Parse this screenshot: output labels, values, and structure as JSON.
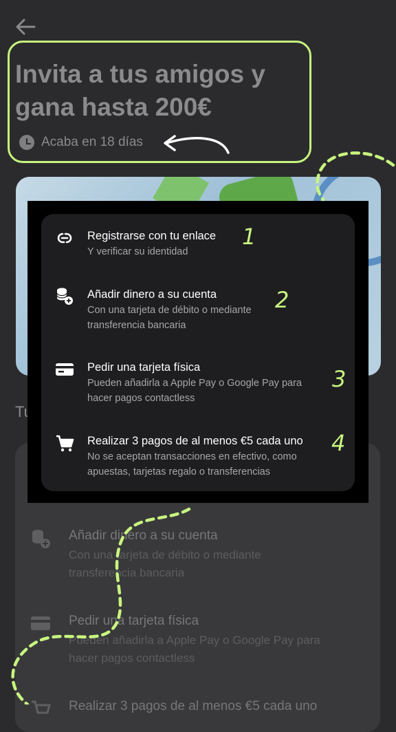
{
  "header": {
    "title": "Invita a tus amigos y gana hasta 200€",
    "countdown": "Acaba en 18 días"
  },
  "section_label": "Tu",
  "overlay_steps": [
    {
      "title": "Registrarse con tu enlace",
      "subtitle": "Y verificar su identidad",
      "number": "1",
      "icon": "link-icon"
    },
    {
      "title": "Añadir dinero a su cuenta",
      "subtitle": "Con una tarjeta de débito o mediante transferencia bancaria",
      "number": "2",
      "icon": "coins-add-icon"
    },
    {
      "title": "Pedir una tarjeta física",
      "subtitle": "Pueden añadirla a Apple Pay o Google Pay para hacer pagos contactless",
      "number": "3",
      "icon": "card-icon"
    },
    {
      "title": "Realizar 3 pagos de al menos €5 cada uno",
      "subtitle": "No se aceptan transacciones en efectivo, como apuestas, tarjetas regalo o transferencias",
      "number": "4",
      "icon": "cart-icon"
    }
  ],
  "background_list": [
    {
      "title": "Añadir dinero a su cuenta",
      "subtitle": "Con una tarjeta de débito o mediante transferencia bancaria",
      "icon": "coins-add-icon"
    },
    {
      "title": "Pedir una tarjeta física",
      "subtitle": "Pueden añadirla a Apple Pay o Google Pay para hacer pagos contactless",
      "icon": "card-icon"
    },
    {
      "title": "Realizar 3 pagos de al menos €5 cada uno",
      "icon": "cart-icon"
    }
  ],
  "colors": {
    "accent": "#c8f57f",
    "background": "#2b2b2d",
    "overlay": "#1e1e20"
  }
}
